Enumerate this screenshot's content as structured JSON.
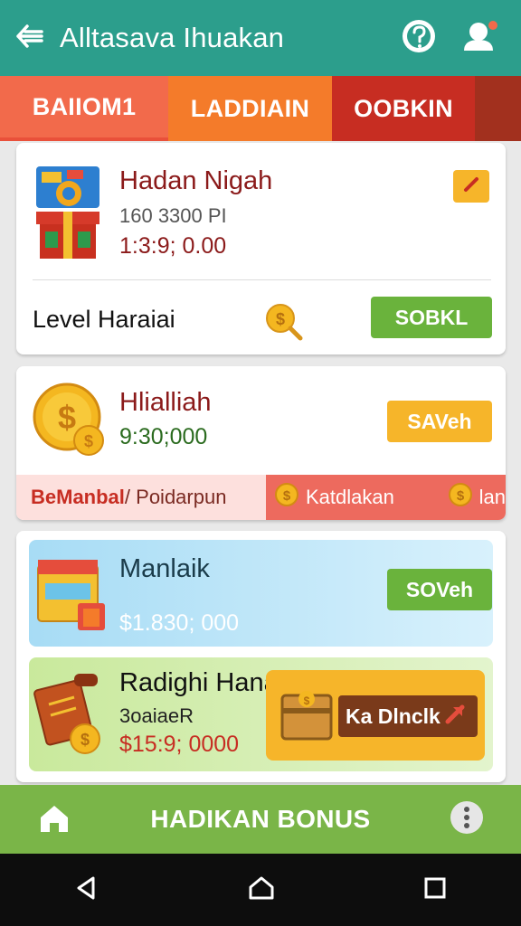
{
  "appbar": {
    "title": "Alltasava Ihuakan"
  },
  "tabs": [
    {
      "label": "BAIIOM1"
    },
    {
      "label": "LADDIAIN"
    },
    {
      "label": "OOBKIN"
    }
  ],
  "cards": {
    "c1": {
      "name": "Hadan Nigah",
      "sub": "160 3300 PI",
      "amount": "1:3:9; 0.00",
      "level_label": "Level Haraiai",
      "button": "SOBKL"
    },
    "c2": {
      "name": "Hlialliah",
      "amount": "9:30;000",
      "button": "SAVeh",
      "footer_left": "BeManbal",
      "footer_left_suffix": " / Poidarpun",
      "footer_right_1": "Katdlakan",
      "footer_right_2": "lan"
    },
    "c3a": {
      "name": "Manlaik",
      "amount": "$1.830; 000",
      "button": "SOVeh"
    },
    "c3b": {
      "name": "Radighi Hana",
      "sub": "3oaiaeR",
      "amount": "$15:9; 0000",
      "cta": "Ka Dlnclk"
    }
  },
  "bottombar": {
    "label": "HADIKAN BONUS"
  },
  "colors": {
    "appbar": "#2c9e8c",
    "primary_green": "#6ab33c",
    "accent_yellow": "#f6b52a",
    "accent_red": "#c72d22"
  },
  "icons": {
    "back": "arrow-left-icon",
    "help": "help-icon",
    "profile": "profile-icon",
    "home": "home-icon",
    "more": "more-vert-icon"
  }
}
